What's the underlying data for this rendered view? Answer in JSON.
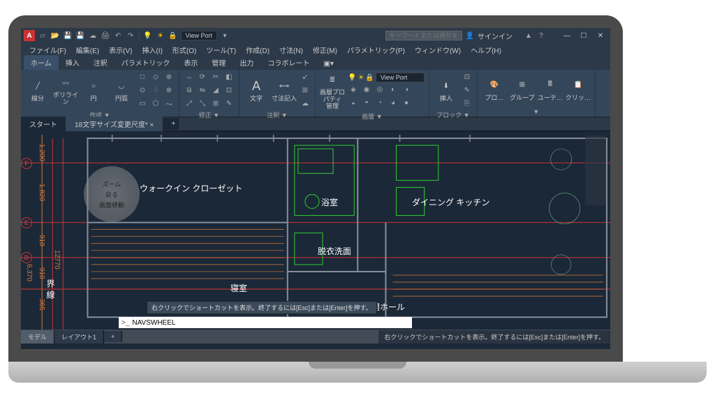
{
  "titlebar": {
    "app_letter": "A",
    "viewport": "View Port",
    "search_placeholder": "キーワードまたは語句を入力",
    "signin": "サインイン"
  },
  "menu": {
    "items": [
      "ファイル(F)",
      "編集(E)",
      "表示(V)",
      "挿入(I)",
      "形式(O)",
      "ツール(T)",
      "作成(D)",
      "寸法(N)",
      "修正(M)",
      "パラメトリック(P)",
      "ウィンドウ(W)",
      "ヘルプ(H)"
    ]
  },
  "ribbon_tabs": [
    "ホーム",
    "挿入",
    "注釈",
    "パラメトリック",
    "表示",
    "管理",
    "出力",
    "コラボレート"
  ],
  "panels": {
    "create": {
      "label": "作成 ▼",
      "btns": {
        "line": "線分",
        "polyline": "ポリライン",
        "circle": "円",
        "arc": "円弧"
      }
    },
    "modify": {
      "label": "修正 ▼"
    },
    "annot": {
      "label": "注釈 ▼",
      "btns": {
        "text": "文字",
        "dim": "寸法記入"
      }
    },
    "layer": {
      "label": "画層 ▼",
      "btns": {
        "mgr": "画層プロパティ\n管理",
        "vp": "View Port"
      }
    },
    "block": {
      "label": "ブロック ▼",
      "btns": {
        "ins": "挿入"
      }
    },
    "props": {
      "label": "▼",
      "btns": {
        "p": "プロ…",
        "g": "グループ",
        "u": "ユーテ…",
        "c": "クリッ…"
      }
    }
  },
  "doctabs": {
    "start": "スタート",
    "file": "18文字サイズ変更尺度*"
  },
  "canvas": {
    "rooms": {
      "walkin": "ウォークイン\nクローゼット",
      "bath": "浴室",
      "dk": "ダイニング\nキッチン",
      "datsui": "脱衣洗面",
      "bed": "寝室",
      "genkan": "玄関ホール"
    },
    "dims": {
      "d1": "1,200",
      "d2": "1,820",
      "d3": "910",
      "d4": "910",
      "d5": "365",
      "t1": "6,370",
      "t2": "12770"
    },
    "markers": {
      "f": "F",
      "e": "E",
      "d": "D"
    },
    "boundary": "界線",
    "navwheel": {
      "zoom": "ズーム",
      "back": "戻る",
      "pan": "画面移動"
    },
    "hint": "右クリックでショートカットを表示。終了するには[Esc]または[Enter]を押す。",
    "cmd_prompt": ">_",
    "cmd": "NAVSWHEEL"
  },
  "status": {
    "model": "モデル",
    "layout": "レイアウト1",
    "hint": "右クリックでショートカットを表示。終了するには[Esc]または[Enter]を押す。"
  }
}
